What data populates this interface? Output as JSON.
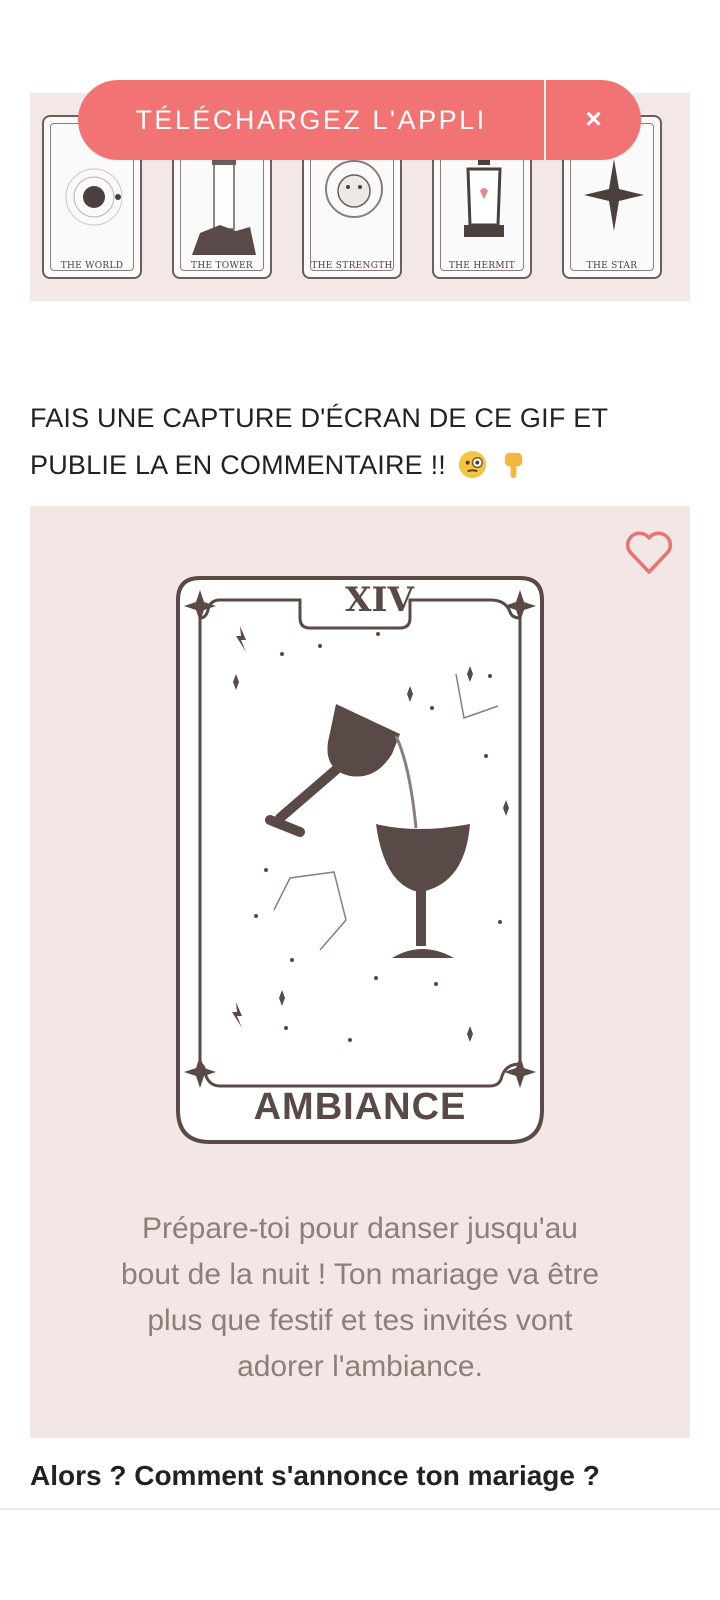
{
  "top_partial_text": "",
  "app_banner": {
    "label": "TÉLÉCHARGEZ L'APPLI",
    "close": "×"
  },
  "tarot_banner": {
    "cards": [
      "THE WORLD",
      "THE TOWER",
      "THE STRENGTH",
      "THE HERMIT",
      "THE STAR"
    ]
  },
  "post": {
    "heading_line1": "FAIS UNE CAPTURE D'ÉCRAN DE CE GIF ET",
    "heading_line2": "PUBLIE LA EN COMMENTAIRE !!",
    "emojis": [
      "face-with-monocle-emoji",
      "backhand-index-pointing-down-emoji"
    ],
    "gif": {
      "numeral": "XIV",
      "card_title": "AMBIANCE",
      "description_lines": [
        "Prépare-toi pour danser jusqu'au",
        "bout de la nuit ! Ton mariage va être",
        "plus que festif et tes invités vont",
        "adorer l'ambiance."
      ]
    },
    "question": "Alors ? Comment s'annonce ton mariage ?"
  },
  "colors": {
    "accent": "#f27373",
    "card_bg": "#f2e7e4",
    "card_ink": "#5a4a47"
  }
}
